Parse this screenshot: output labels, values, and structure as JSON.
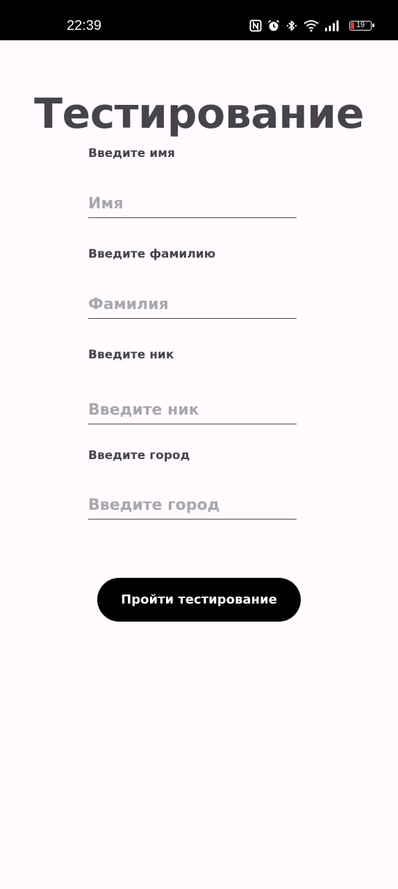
{
  "status_bar": {
    "time": "22:39",
    "icons": [
      "nfc-icon",
      "alarm-icon",
      "bluetooth-icon",
      "wifi-icon",
      "signal-icon",
      "battery-icon"
    ],
    "battery_level": "19",
    "battery_fraction": 0.19,
    "battery_color": "#e53935"
  },
  "title": "Тестирование",
  "form": {
    "fields": [
      {
        "label": "Введите имя",
        "placeholder": "Имя",
        "value": ""
      },
      {
        "label": "Введите фамилию",
        "placeholder": "Фамилия",
        "value": ""
      },
      {
        "label": "Введите ник",
        "placeholder": "Введите ник",
        "value": ""
      },
      {
        "label": "Введите город",
        "placeholder": "Введите город",
        "value": ""
      }
    ],
    "submit_label": "Пройти тестирование"
  },
  "colors": {
    "background": "#fffbfe",
    "text": "#47434d",
    "placeholder": "#a9a6ad",
    "button": "#000000",
    "button_text": "#ffffff"
  }
}
